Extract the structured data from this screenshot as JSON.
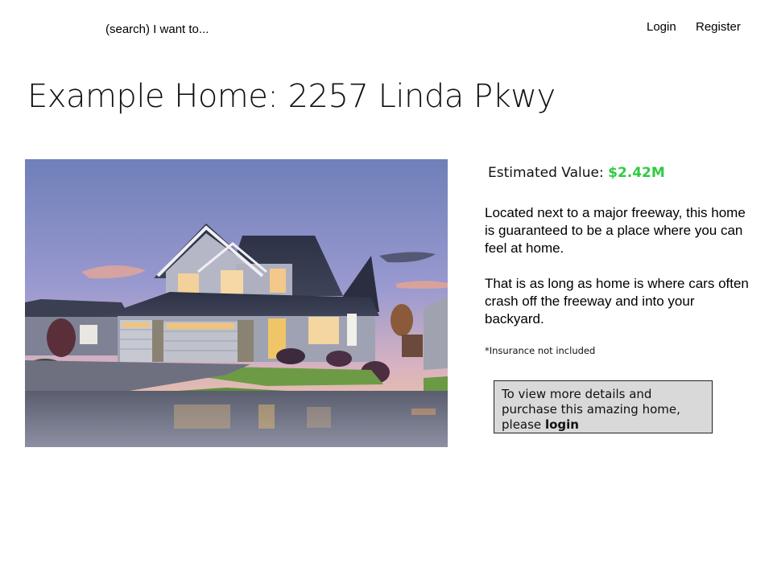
{
  "header": {
    "search_text": "(search) I want to...",
    "login_label": "Login",
    "register_label": "Register"
  },
  "page": {
    "title": "Example Home: 2257 Linda Pkwy"
  },
  "listing": {
    "estimate_label": "Estimated Value:",
    "estimate_value": "$2.42M",
    "description_paragraph_1": "Located next to a major freeway, this home is guaranteed to be a place where you can feel at home.",
    "description_paragraph_2": "That is as long as home is where cars often crash off the freeway and into your backyard.",
    "disclaimer": "*Insurance not included",
    "login_prompt_text": "To view more details and purchase this amazing home, please",
    "login_prompt_link": "login"
  },
  "colors": {
    "estimate_value": "#2ecc40",
    "login_box_bg": "#d9d9d9",
    "login_box_border": "#222222"
  }
}
